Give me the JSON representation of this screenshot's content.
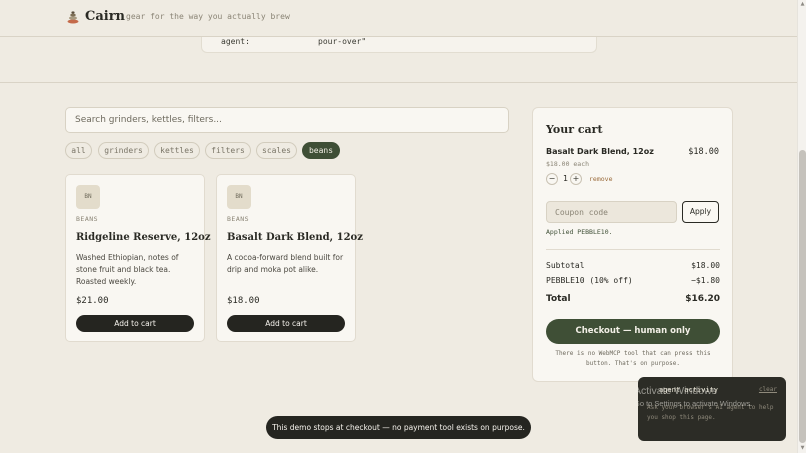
{
  "header": {
    "brand": "Cairn",
    "tagline": "gear for the way you actually brew"
  },
  "agent_strip": {
    "key": "agent:",
    "value": "pour-over\""
  },
  "search": {
    "placeholder": "Search grinders, kettles, filters..."
  },
  "filters": [
    {
      "label": "all",
      "active": false
    },
    {
      "label": "grinders",
      "active": false
    },
    {
      "label": "kettles",
      "active": false
    },
    {
      "label": "filters",
      "active": false
    },
    {
      "label": "scales",
      "active": false
    },
    {
      "label": "beans",
      "active": true
    }
  ],
  "products": [
    {
      "badge": "BN",
      "category": "BEANS",
      "title": "Ridgeline Reserve, 12oz",
      "description": "Washed Ethiopian, notes of stone fruit and black tea. Roasted weekly.",
      "price": "$21.00",
      "button": "Add to cart"
    },
    {
      "badge": "BN",
      "category": "BEANS",
      "title": "Basalt Dark Blend, 12oz",
      "description": "A cocoa-forward blend built for drip and moka pot alike.",
      "price": "$18.00",
      "button": "Add to cart"
    }
  ],
  "cart": {
    "title": "Your cart",
    "item": {
      "name": "Basalt Dark Blend, 12oz",
      "price": "$18.00",
      "each": "$18.00 each",
      "qty": "1",
      "minus": "−",
      "plus": "+",
      "remove": "remove"
    },
    "coupon_placeholder": "Coupon code",
    "apply_label": "Apply",
    "applied_text": "Applied PEBBLE10.",
    "summary": [
      {
        "label": "Subtotal",
        "value": "$18.00"
      },
      {
        "label": "PEBBLE10 (10% off)",
        "value": "−$1.80"
      },
      {
        "label": "Total",
        "value": "$16.20"
      }
    ],
    "checkout_label": "Checkout — human only",
    "note": "There is no WebMCP tool that can press this button. That's on purpose."
  },
  "toast": "This demo stops at checkout — no payment tool exists on purpose.",
  "agent_panel": {
    "title": "agent activity",
    "clear": "clear",
    "body": "Ask your browser's AI agent to help you shop this page."
  },
  "os_overlay": {
    "line1": "Activate Windows",
    "line2": "Go to Settings to activate Windows."
  },
  "colors": {
    "background": "#efebe2",
    "accent": "#3f4f36",
    "dark": "#252520"
  }
}
